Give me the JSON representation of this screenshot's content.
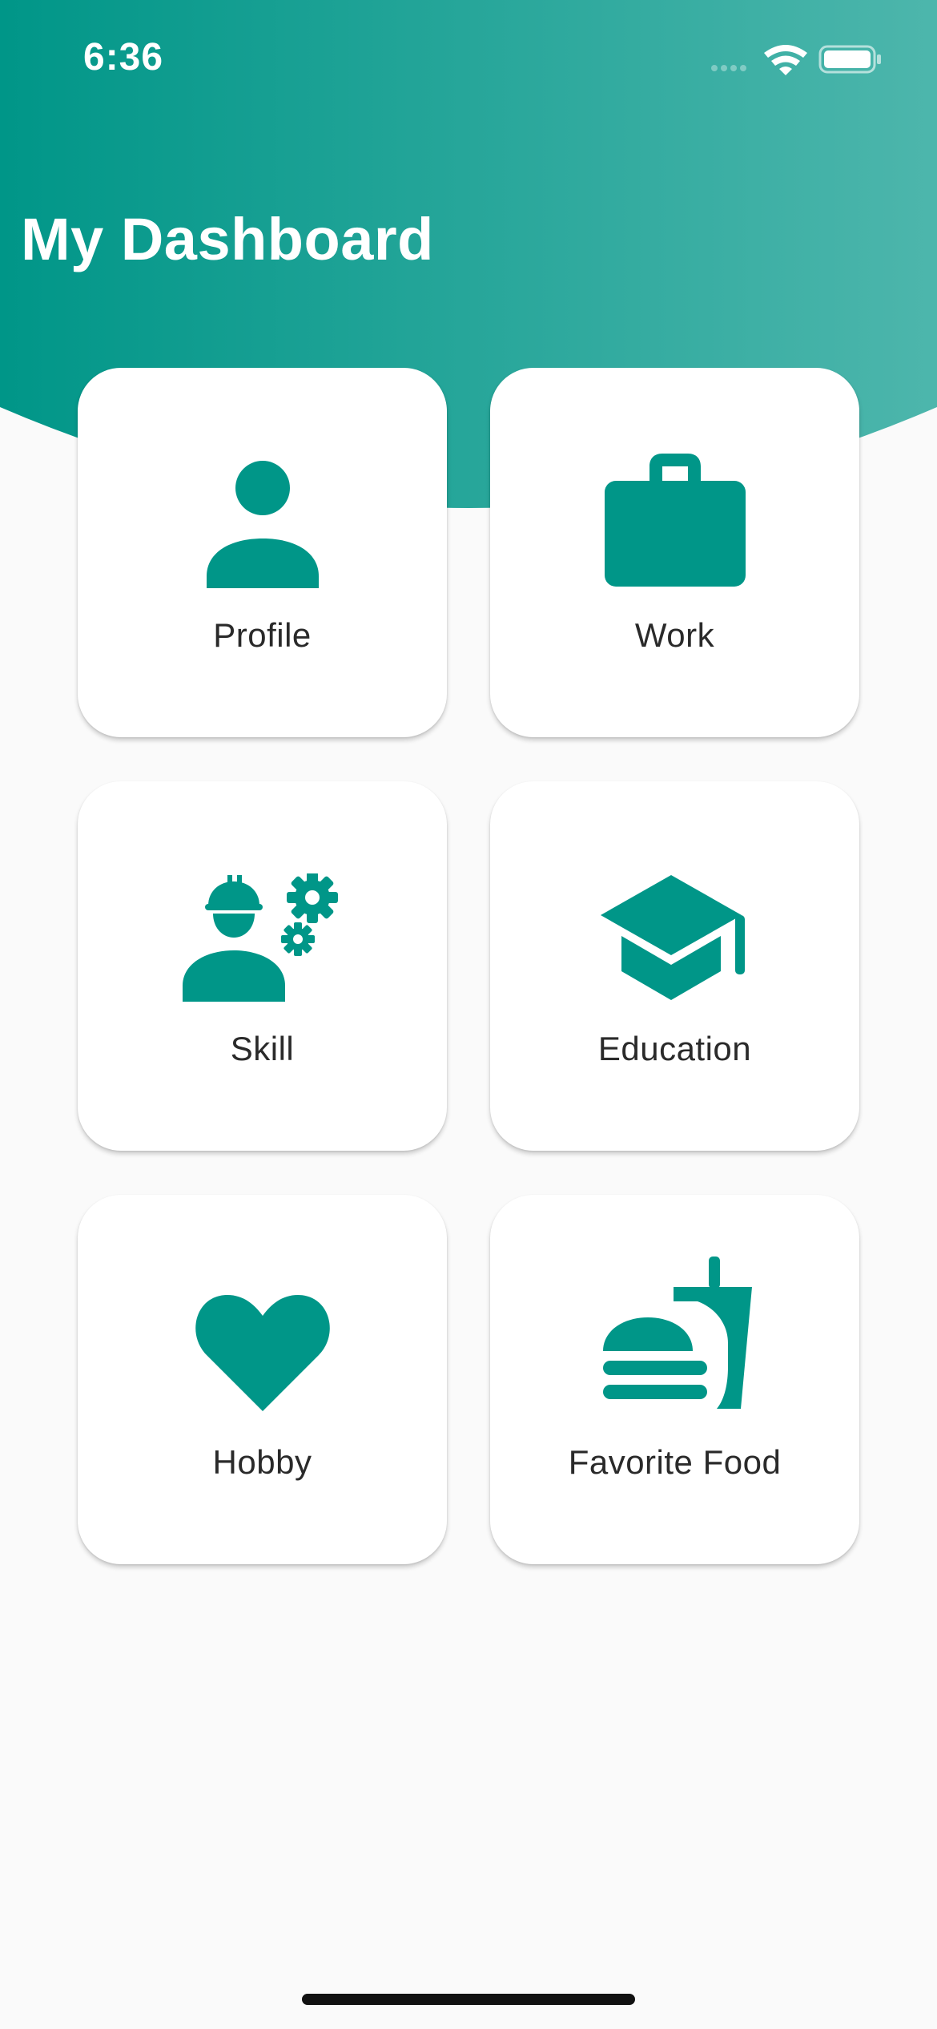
{
  "status_bar": {
    "time": "6:36",
    "icons": [
      "signal-icon",
      "wifi-icon",
      "battery-icon"
    ]
  },
  "header": {
    "title": "My Dashboard"
  },
  "theme": {
    "primary": "#009688",
    "primary_light": "#4db6ac",
    "background": "#fafafa",
    "card": "#ffffff",
    "label_text": "#2a2a2a"
  },
  "cards": [
    {
      "label": "Profile",
      "icon": "person-icon"
    },
    {
      "label": "Work",
      "icon": "briefcase-icon"
    },
    {
      "label": "Skill",
      "icon": "engineer-icon"
    },
    {
      "label": "Education",
      "icon": "graduation-cap-icon"
    },
    {
      "label": "Hobby",
      "icon": "heart-icon"
    },
    {
      "label": "Favorite Food",
      "icon": "fastfood-icon"
    }
  ]
}
